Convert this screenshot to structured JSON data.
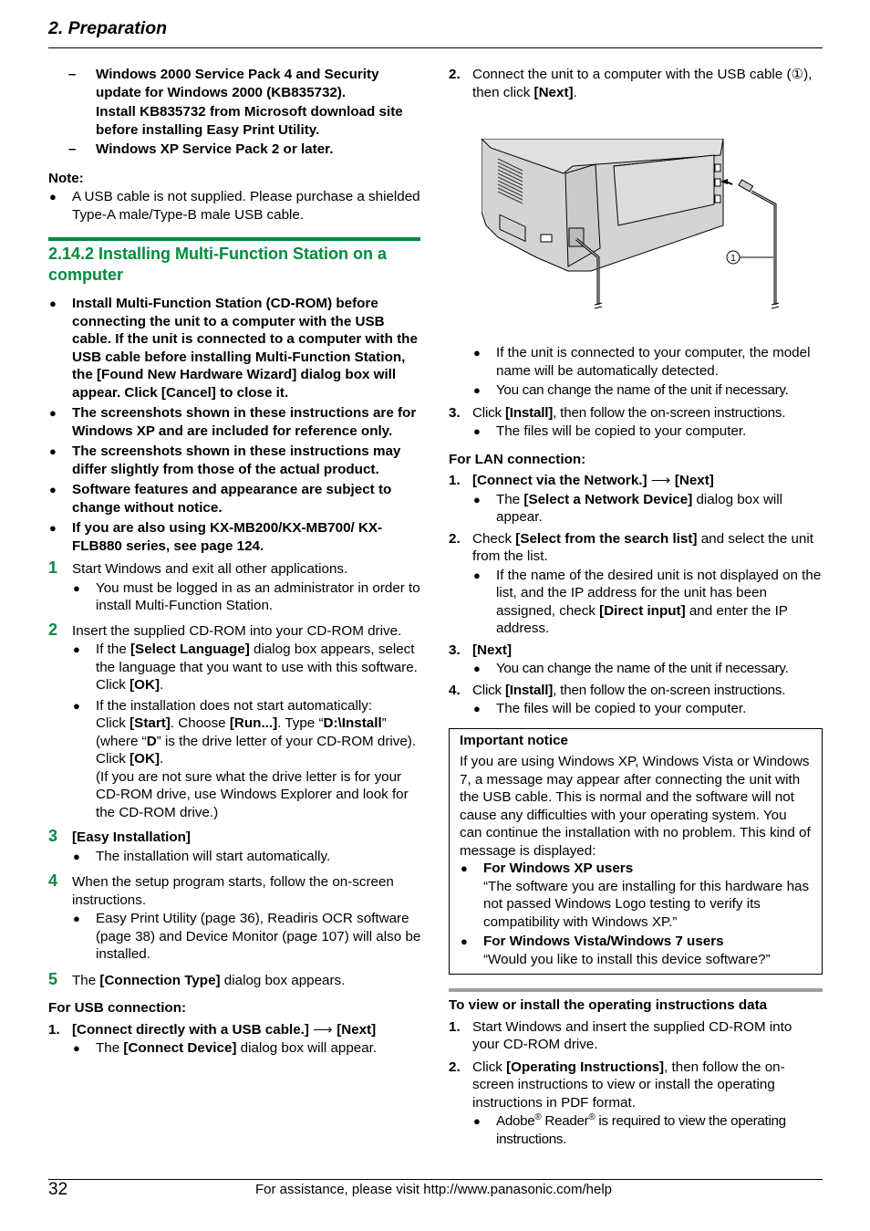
{
  "header": {
    "title": "2. Preparation"
  },
  "left": {
    "requirements": [
      {
        "marker": "–",
        "text": "Windows 2000 Service Pack 4 and Security update for Windows 2000 (KB835732).",
        "subtext": "Install KB835732 from Microsoft download site before installing Easy Print Utility."
      },
      {
        "marker": "–",
        "text": "Windows XP Service Pack 2 or later."
      }
    ],
    "note_label": "Note:",
    "note_items": [
      "A USB cable is not supplied. Please purchase a shielded Type-A male/Type-B male USB cable."
    ],
    "section_title": "2.14.2 Installing Multi-Function Station on a computer",
    "cautions": [
      "Install Multi-Function Station (CD-ROM) before connecting the unit to a computer with the USB cable. If the unit is connected to a computer with the USB cable before installing Multi-Function Station, the [Found New Hardware Wizard] dialog box will appear. Click [Cancel] to close it.",
      "The screenshots shown in these instructions are for Windows XP and are included for reference only.",
      "The screenshots shown in these instructions may differ slightly from those of the actual product.",
      "Software features and appearance are subject to change without notice.",
      "If you are also using KX-MB200/KX-MB700/ KX-FLB880 series, see page 124."
    ],
    "steps": [
      {
        "num": "1",
        "text": "Start Windows and exit all other applications.",
        "bullets": [
          "You must be logged in as an administrator in order to install Multi-Function Station."
        ]
      },
      {
        "num": "2",
        "text": "Insert the supplied CD-ROM into your CD-ROM drive.",
        "b1_pre": "If the ",
        "b1_bold": "[Select Language]",
        "b1_post": " dialog box appears, select the language that you want to use with this software. Click ",
        "b1_bold2": "[OK]",
        "b1_end": ".",
        "b2_line1": "If the installation does not start automatically:",
        "b2_click": "Click ",
        "b2_start": "[Start]",
        "b2_choose": ". Choose ",
        "b2_run": "[Run...]",
        "b2_type": ". Type “",
        "b2_path": "D:\\Install",
        "b2_where": "” (where “",
        "b2_d": "D",
        "b2_rest": "” is the drive letter of your CD-ROM drive). Click ",
        "b2_ok": "[OK]",
        "b2_end": ".",
        "b2_paren": "(If you are not sure what the drive letter is for your CD-ROM drive, use Windows Explorer and look for the CD-ROM drive.)"
      },
      {
        "num": "3",
        "text": "[Easy Installation]",
        "bullets": [
          "The installation will start automatically."
        ]
      },
      {
        "num": "4",
        "text": "When the setup program starts, follow the on-screen instructions.",
        "bullets": [
          "Easy Print Utility (page 36), Readiris OCR software (page 38) and Device Monitor (page 107) will also be installed."
        ]
      },
      {
        "num": "5",
        "pre": "The ",
        "bold": "[Connection Type]",
        "post": " dialog box appears."
      }
    ],
    "usb_label": "For USB connection:",
    "usb_step1": {
      "num": "1.",
      "a": "[Connect directly with a USB cable.]",
      "arrow": "⟶",
      "b": "[Next]",
      "bullet_pre": "The ",
      "bullet_bold": "[Connect Device]",
      "bullet_post": " dialog box will appear."
    }
  },
  "right": {
    "usb_step2": {
      "num": "2.",
      "pre": "Connect the unit to a computer with the USB cable (",
      "circ": "①",
      "mid": "), then click ",
      "bold": "[Next]",
      "end": "."
    },
    "illustration": {
      "callout": "1"
    },
    "usb_step2_bullets": [
      "If the unit is connected to your computer, the model name will be automatically detected.",
      "You can change the name of the unit if necessary."
    ],
    "usb_step3": {
      "num": "3.",
      "pre": "Click ",
      "bold": "[Install]",
      "post": ", then follow the on-screen instructions.",
      "bullet": "The files will be copied to your computer."
    },
    "lan_label": "For LAN connection:",
    "lan_steps": [
      {
        "num": "1.",
        "a": "[Connect via the Network.]",
        "arrow": "⟶",
        "b": "[Next]",
        "bullet_pre": "The ",
        "bullet_bold": "[Select a Network Device]",
        "bullet_post": " dialog box will appear."
      },
      {
        "num": "2.",
        "pre": "Check ",
        "bold": "[Select from the search list]",
        "post": " and select the unit from the list.",
        "bullet_pre": "If the name of the desired unit is not displayed on the list, and the IP address for the unit has been assigned, check ",
        "bullet_bold": "[Direct input]",
        "bullet_post": " and enter the IP address."
      },
      {
        "num": "3.",
        "bold": "[Next]",
        "bullet": "You can change the name of the unit if necessary."
      },
      {
        "num": "4.",
        "pre": "Click ",
        "bold": "[Install]",
        "post": ", then follow the on-screen instructions.",
        "bullet": "The files will be copied to your computer."
      }
    ],
    "notice": {
      "title": "Important notice",
      "body": "If you are using Windows XP, Windows Vista or Windows 7, a message may appear after connecting the unit with the USB cable. This is normal and the software will not cause any difficulties with your operating system. You can continue the installation with no problem. This kind of message is displayed:",
      "items": [
        {
          "label": "For Windows XP users",
          "text": "“The software you are installing for this hardware has not passed Windows Logo testing to verify its compatibility with Windows XP.”"
        },
        {
          "label": "For Windows Vista/Windows 7 users",
          "text": "“Would you like to install this device software?”"
        }
      ]
    },
    "oi_title": "To view or install the operating instructions data",
    "oi_steps": [
      {
        "num": "1.",
        "text": "Start Windows and insert the supplied CD-ROM into your CD-ROM drive."
      },
      {
        "num": "2.",
        "pre": "Click ",
        "bold": "[Operating Instructions]",
        "post": ", then follow the on-screen instructions to view or install the operating instructions in PDF format.",
        "b_adobe": "Adobe",
        "b_reg": "®",
        "b_reader": " Reader",
        "b_rest": " is required to view the operating instructions."
      }
    ]
  },
  "footer": {
    "page_number": "32",
    "text": "For assistance, please visit http://www.panasonic.com/help"
  },
  "colors": {
    "accent_green": "#008a3e",
    "rule_grey": "#a0a0a0"
  }
}
